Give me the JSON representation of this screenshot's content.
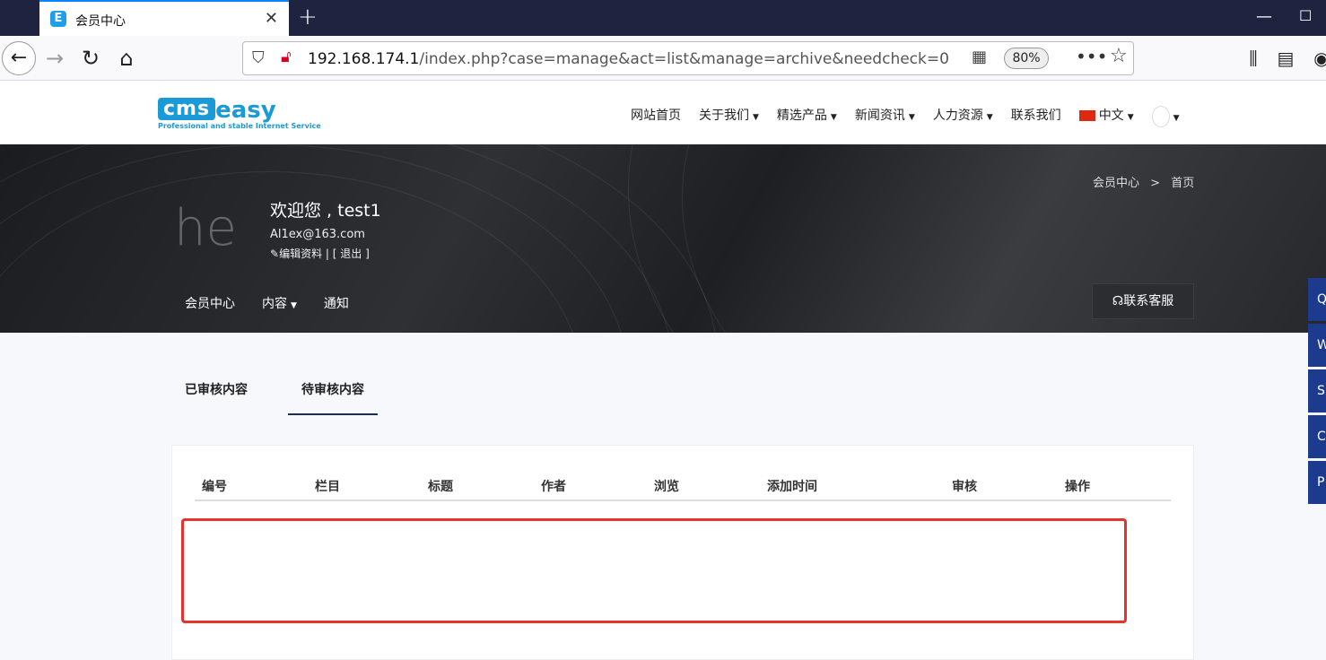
{
  "browser": {
    "tab_title": "会员中心",
    "url_host": "192.168.174.1",
    "url_path": "/index.php?case=manage&act=list&manage=archive&needcheck=0",
    "zoom": "80%"
  },
  "site": {
    "logo_text_cms": "cms",
    "logo_text_easy": "easy",
    "logo_tagline": "Professional and stable Internet Service",
    "menu": [
      {
        "label": "网站首页",
        "dropdown": false
      },
      {
        "label": "关于我们",
        "dropdown": true
      },
      {
        "label": "精选产品",
        "dropdown": true
      },
      {
        "label": "新闻资讯",
        "dropdown": true
      },
      {
        "label": "人力资源",
        "dropdown": true
      },
      {
        "label": "联系我们",
        "dropdown": false
      },
      {
        "label": "中文",
        "dropdown": true
      }
    ]
  },
  "banner": {
    "avatar_ghost": "he",
    "welcome": "欢迎您 , test1",
    "email": "Al1ex@163.com",
    "edit_label": "编辑资料",
    "logout_label": "| [ 退出 ]",
    "breadcrumb_1": "会员中心",
    "breadcrumb_sep": ">",
    "breadcrumb_2": "首页",
    "subnav": [
      "会员中心",
      "内容",
      "通知"
    ],
    "service_label": "联系客服"
  },
  "content": {
    "tabs": [
      "已审核内容",
      "待审核内容"
    ],
    "active_tab": 1,
    "table_headers": [
      "编号",
      "栏目",
      "标题",
      "作者",
      "浏览",
      "添加时间",
      "审核",
      "操作"
    ],
    "rows": []
  }
}
